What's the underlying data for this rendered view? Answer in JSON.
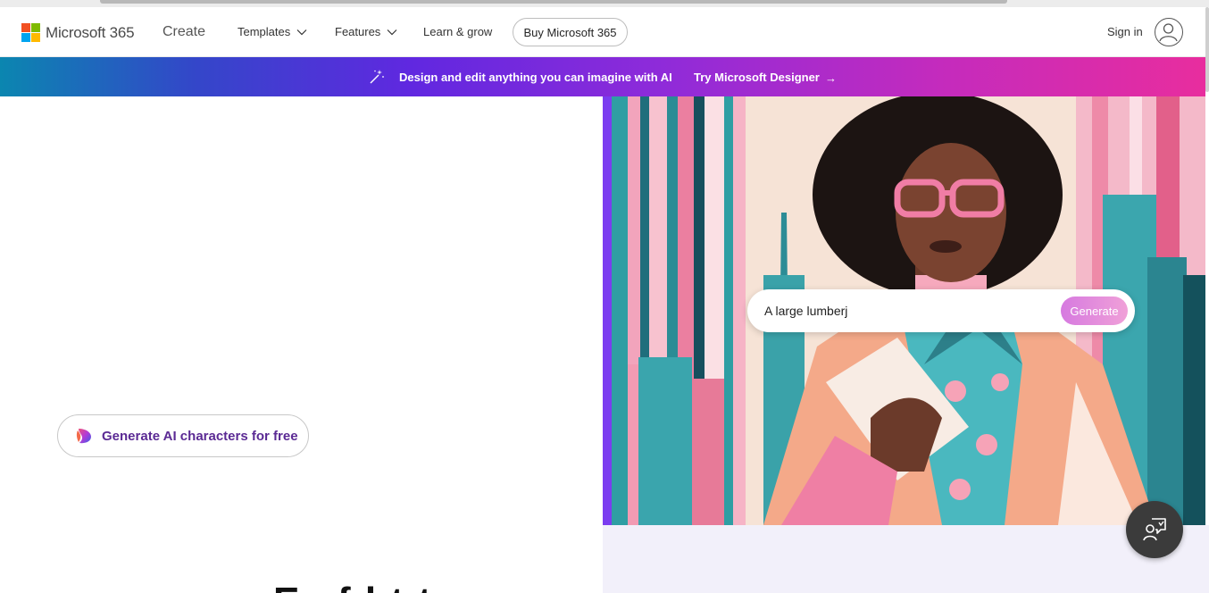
{
  "header": {
    "brand": "Microsoft 365",
    "section": "Create",
    "nav": [
      {
        "label": "Templates",
        "has_dropdown": true
      },
      {
        "label": "Features",
        "has_dropdown": true
      },
      {
        "label": "Learn & grow",
        "has_dropdown": false
      }
    ],
    "buy_label": "Buy Microsoft 365",
    "signin_label": "Sign in",
    "logo_colors": [
      "#f25022",
      "#7fba00",
      "#00a4ef",
      "#ffb900"
    ]
  },
  "banner": {
    "icon": "magic-wand-icon",
    "message": "Design and edit anything you can imagine with AI",
    "cta": "Try Microsoft Designer",
    "cta_arrow": "→"
  },
  "main": {
    "pill_label": "Generate AI characters for free",
    "pill_icon": "designer-logo-icon",
    "prompt_value": "A large lumberj",
    "generate_label": "Generate",
    "bottom_heading_partial": "Ex        f     l      t           t"
  },
  "chat": {
    "icon": "chat-assistant-icon"
  },
  "colors": {
    "pill_text": "#5b2a94",
    "banner_start": "#0b86b0",
    "banner_end": "#e82d9e",
    "generate_button": "#d67ae0"
  }
}
